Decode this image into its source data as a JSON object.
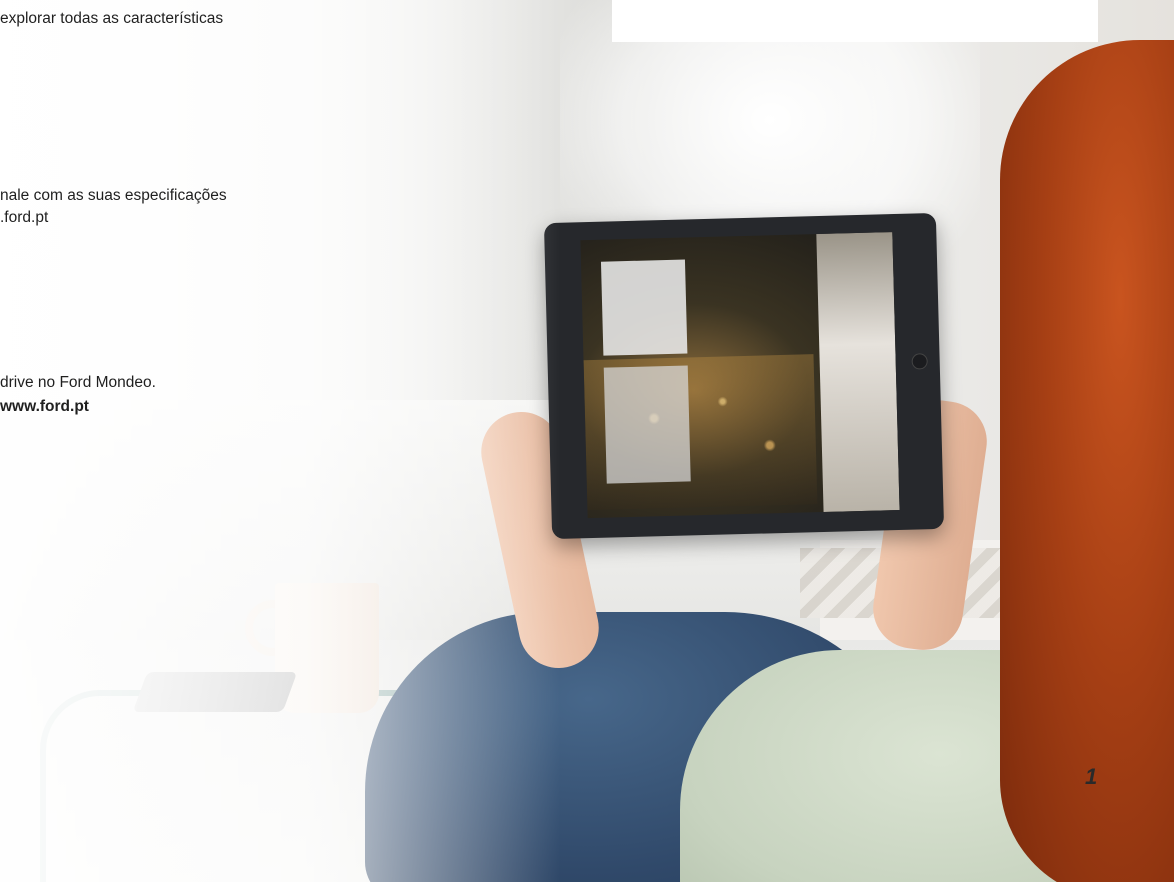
{
  "text_lines": [
    "explorar todas as características",
    "nale com as suas especificações",
    ".ford.pt",
    "drive no Ford Mondeo.",
    "www.ford.pt"
  ],
  "page_number": "1",
  "colors": {
    "text": "#1f1f1f",
    "hair": "#a63f14",
    "jeans": "#30496a",
    "shirt": "#c7d3bf"
  }
}
